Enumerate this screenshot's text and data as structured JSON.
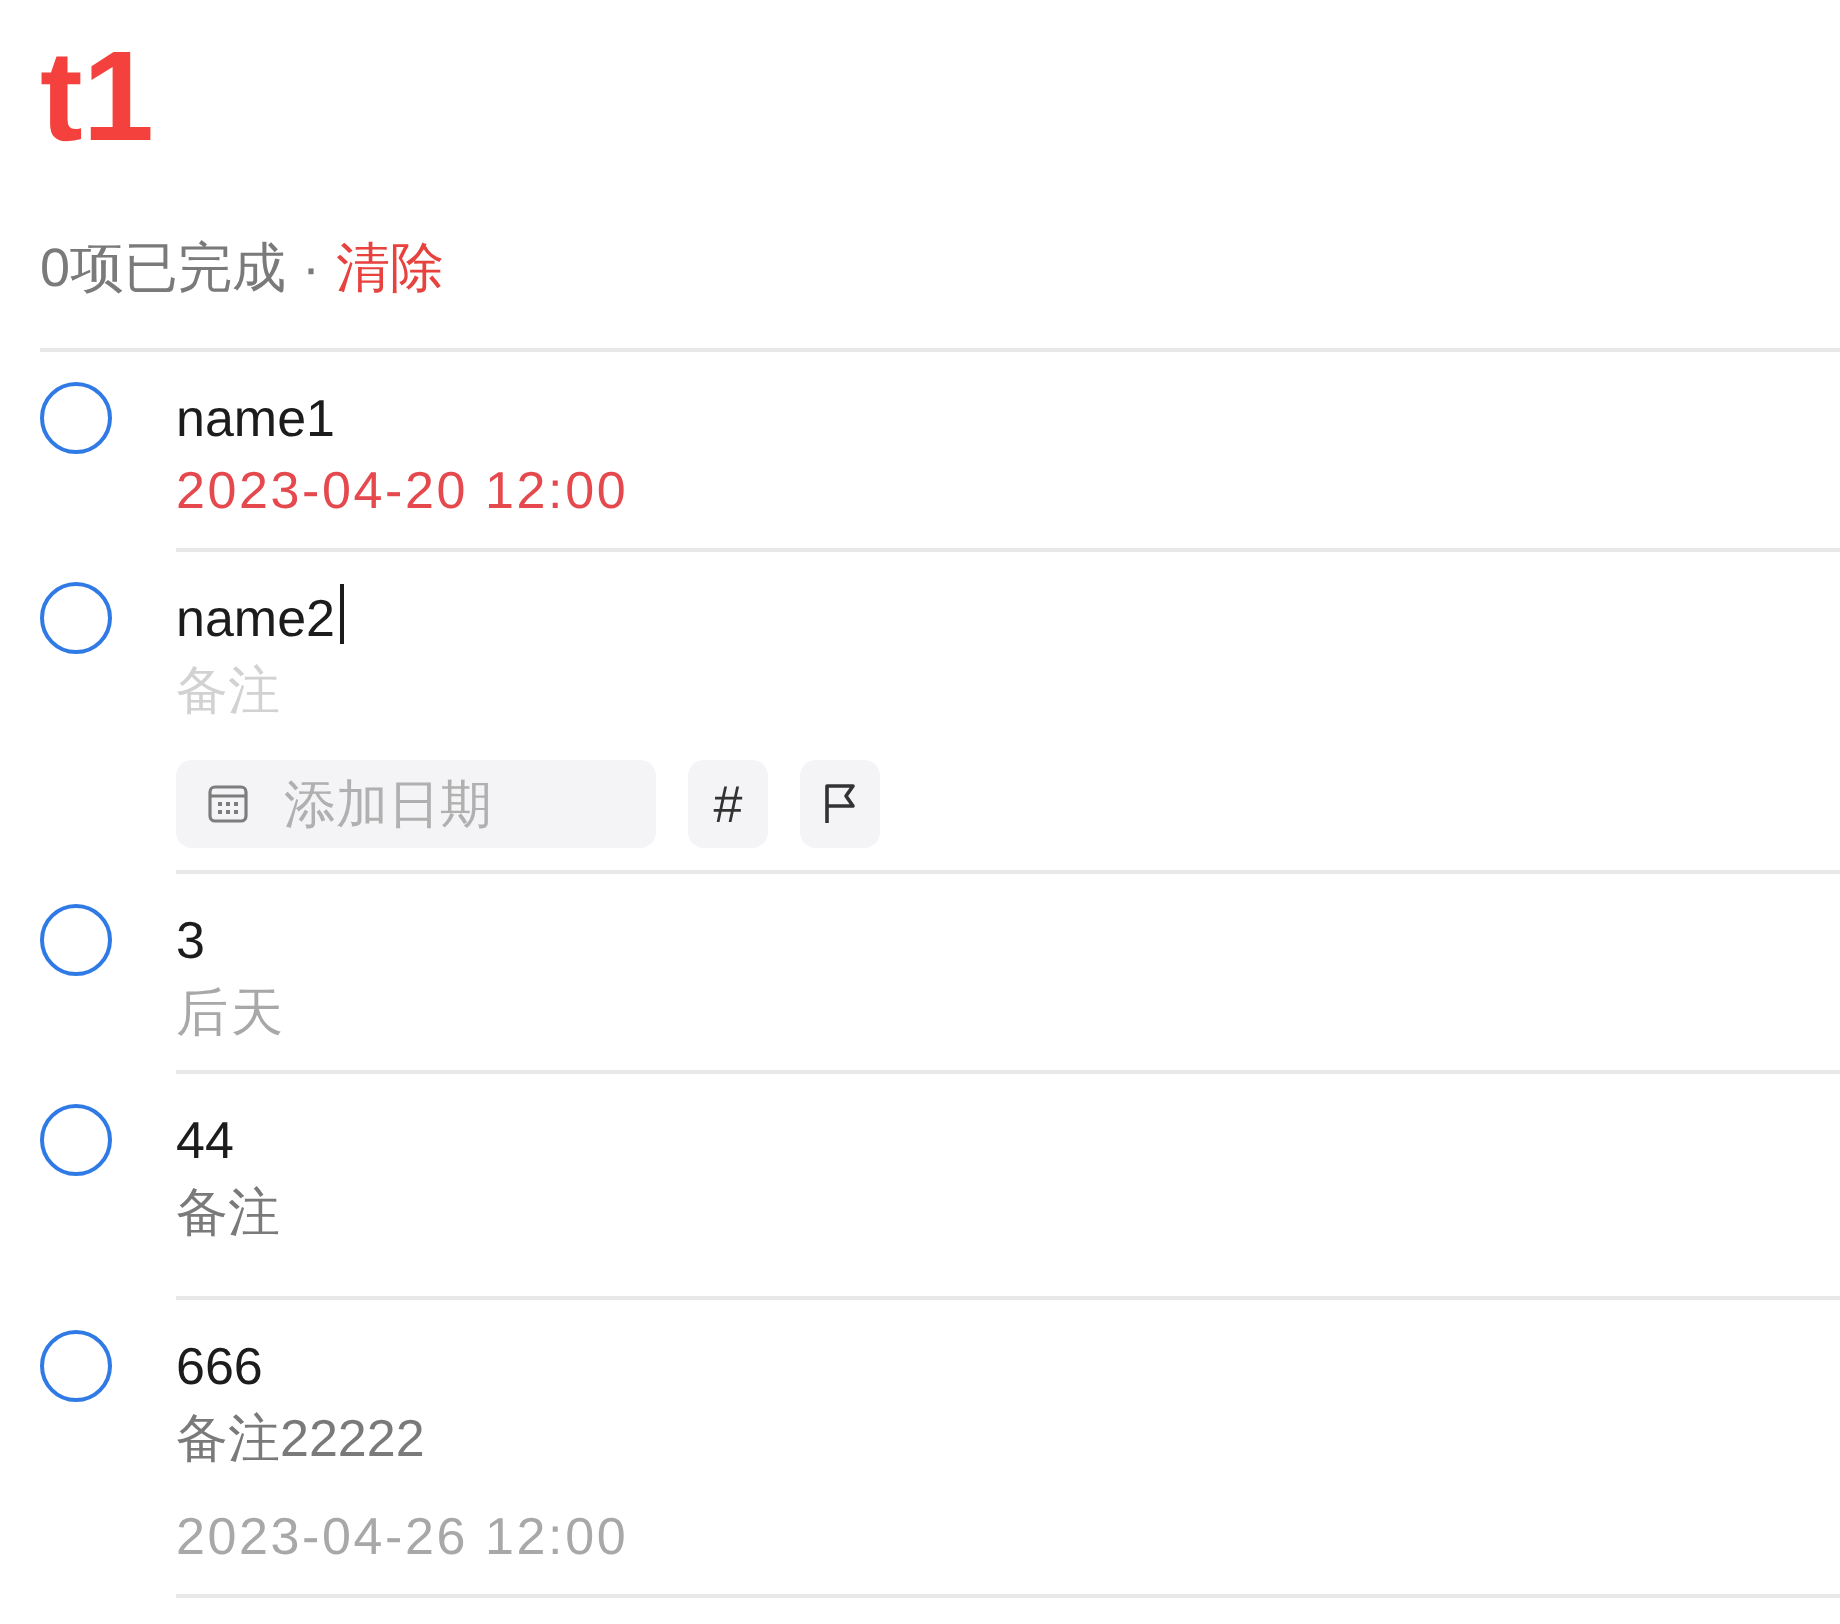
{
  "list": {
    "title": "t1"
  },
  "summary": {
    "count_text": "0项已完成",
    "separator": "·",
    "clear_link": "清除"
  },
  "tasks": [
    {
      "name": "name1",
      "checked": false,
      "editing": false,
      "due": "2023-04-20 12:00",
      "overdue": true
    },
    {
      "name": "name2",
      "checked": false,
      "editing": true,
      "note_field": {
        "placeholder": "备注"
      },
      "date_field": {
        "placeholder": "添加日期"
      },
      "tag_button": "#"
    },
    {
      "name": "3",
      "checked": false,
      "editing": false,
      "due": "后天",
      "overdue": false
    },
    {
      "name": "44",
      "checked": false,
      "editing": false,
      "note": "备注"
    },
    {
      "name": "666",
      "checked": false,
      "editing": false,
      "note": "备注22222",
      "due": "2023-04-26 12:00",
      "overdue": false
    }
  ]
}
